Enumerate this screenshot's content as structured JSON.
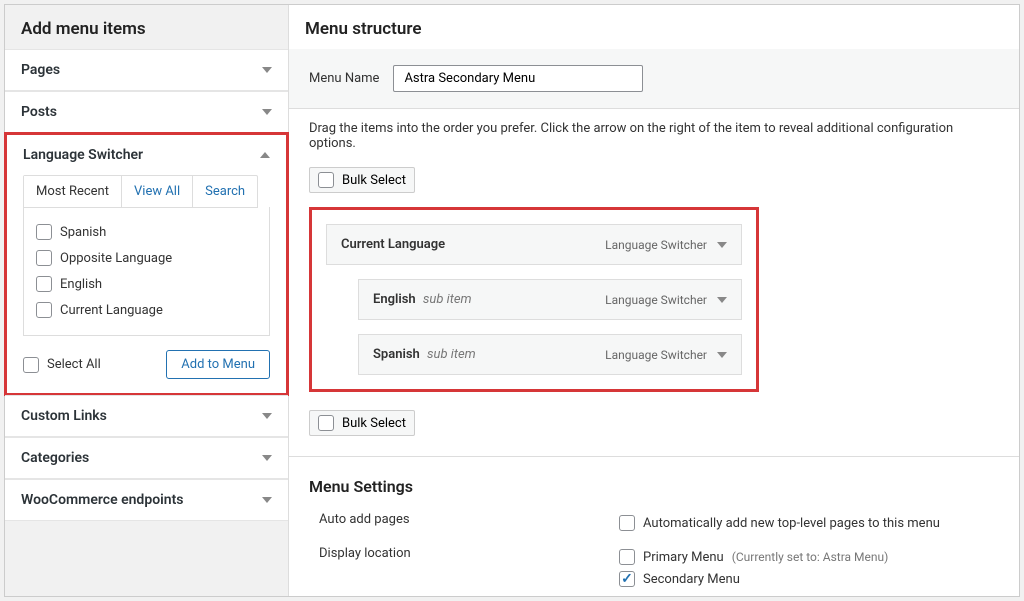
{
  "left": {
    "title": "Add menu items",
    "accordions": {
      "pages": "Pages",
      "posts": "Posts",
      "language_switcher": "Language Switcher",
      "custom_links": "Custom Links",
      "categories": "Categories",
      "woocommerce": "WooCommerce endpoints"
    },
    "tabs": {
      "most_recent": "Most Recent",
      "view_all": "View All",
      "search": "Search"
    },
    "options": [
      "Spanish",
      "Opposite Language",
      "English",
      "Current Language"
    ],
    "select_all": "Select All",
    "add_to_menu": "Add to Menu"
  },
  "right": {
    "title": "Menu structure",
    "menu_name_label": "Menu Name",
    "menu_name_value": "Astra Secondary Menu",
    "instructions": "Drag the items into the order you prefer. Click the arrow on the right of the item to reveal additional configuration options.",
    "bulk_select": "Bulk Select",
    "items": [
      {
        "title": "Current Language",
        "sub": false,
        "type": "Language Switcher"
      },
      {
        "title": "English",
        "sub": true,
        "type": "Language Switcher"
      },
      {
        "title": "Spanish",
        "sub": true,
        "type": "Language Switcher"
      }
    ],
    "sub_item_label": "sub item",
    "settings": {
      "title": "Menu Settings",
      "auto_add_label": "Auto add pages",
      "auto_add_option": "Automatically add new top-level pages to this menu",
      "display_location_label": "Display location",
      "primary_menu": "Primary Menu",
      "primary_note": "(Currently set to: Astra Menu)",
      "secondary_menu": "Secondary Menu"
    }
  }
}
